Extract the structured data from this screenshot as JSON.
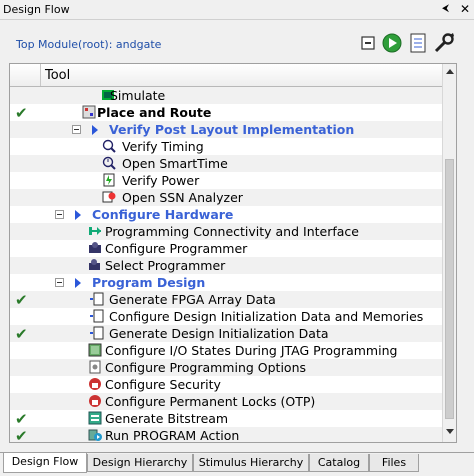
{
  "window": {
    "title": "Design Flow",
    "pin_glyph": "⮜",
    "close_glyph": "✕"
  },
  "toolbar": {
    "top_module": "Top Module(root): andgate"
  },
  "table": {
    "column_header": "Tool"
  },
  "rows": [
    {
      "label": "Simulate",
      "icon": "simulate-icon"
    },
    {
      "label": "Place and Route",
      "checked": true,
      "icon": "place-route-icon"
    },
    {
      "label": "Verify Post Layout Implementation",
      "section": true
    },
    {
      "label": "Verify Timing",
      "icon": "timing-icon"
    },
    {
      "label": "Open SmartTime",
      "icon": "smarttime-icon"
    },
    {
      "label": "Verify Power",
      "icon": "power-icon"
    },
    {
      "label": "Open SSN Analyzer",
      "icon": "ssn-icon"
    },
    {
      "label": "Configure Hardware",
      "section": true
    },
    {
      "label": "Programming Connectivity and Interface",
      "icon": "connectivity-icon"
    },
    {
      "label": "Configure Programmer",
      "icon": "programmer-icon"
    },
    {
      "label": "Select Programmer",
      "icon": "select-programmer-icon"
    },
    {
      "label": "Program Design",
      "section": true
    },
    {
      "label": "Generate FPGA Array Data",
      "checked": true,
      "icon": "doc-icon"
    },
    {
      "label": "Configure Design Initialization Data and Memories",
      "icon": "doc-icon"
    },
    {
      "label": "Generate Design Initialization Data",
      "checked": true,
      "icon": "doc-icon"
    },
    {
      "label": "Configure I/O States During JTAG Programming",
      "icon": "io-states-icon"
    },
    {
      "label": "Configure Programming Options",
      "icon": "options-icon"
    },
    {
      "label": "Configure Security",
      "icon": "security-icon"
    },
    {
      "label": "Configure Permanent Locks (OTP)",
      "icon": "lock-icon"
    },
    {
      "label": "Generate Bitstream",
      "checked": true,
      "icon": "bitstream-icon"
    },
    {
      "label": "Run PROGRAM Action",
      "checked": true,
      "icon": "run-icon"
    }
  ],
  "check_glyph": "✔",
  "tabs": [
    {
      "label": "Design Flow",
      "active": true
    },
    {
      "label": "Design Hierarchy"
    },
    {
      "label": "Stimulus Hierarchy"
    },
    {
      "label": "Catalog"
    },
    {
      "label": "Files"
    }
  ],
  "colors": {
    "section_text": "#3a62d6",
    "check": "#2a7a2a",
    "top_module": "#1f4ea8"
  }
}
